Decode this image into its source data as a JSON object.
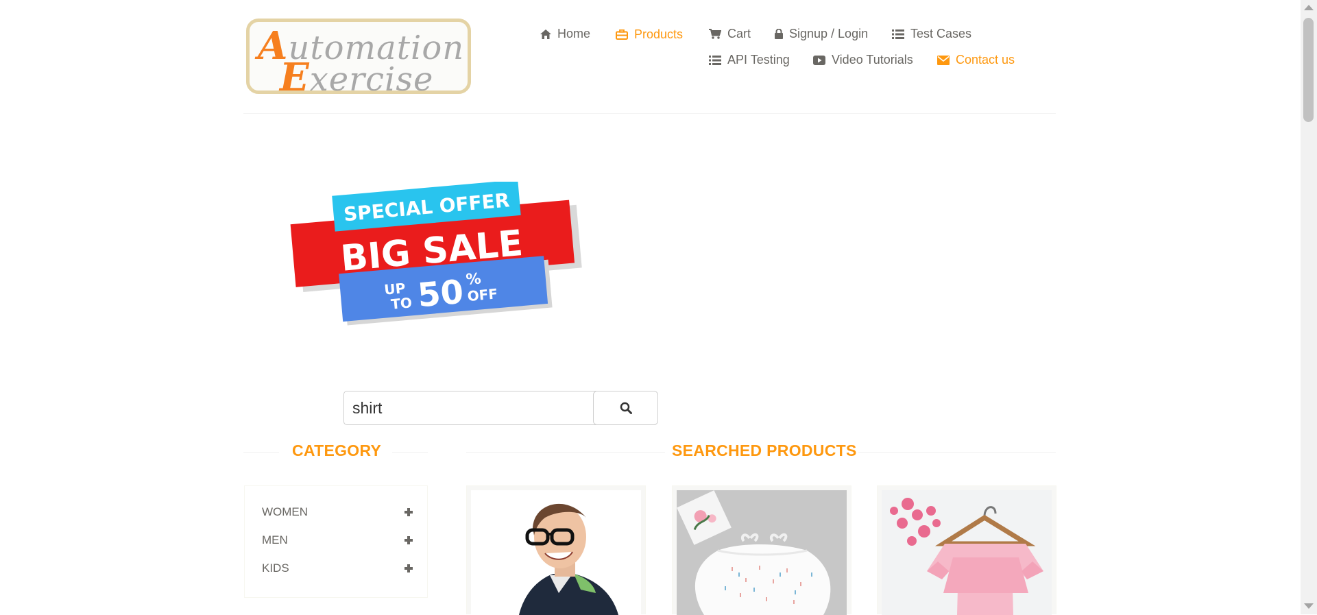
{
  "logo": {
    "line1_cap": "A",
    "line1_rest": "utomation",
    "line2_cap": "E",
    "line2_rest": "xercise"
  },
  "nav": [
    {
      "label": "Home",
      "icon": "home-icon"
    },
    {
      "label": "Products",
      "icon": "briefcase-icon",
      "active": true
    },
    {
      "label": "Cart",
      "icon": "cart-icon"
    },
    {
      "label": "Signup / Login",
      "icon": "lock-icon"
    },
    {
      "label": "Test Cases",
      "icon": "list-icon"
    },
    {
      "label": "API Testing",
      "icon": "list-icon"
    },
    {
      "label": "Video Tutorials",
      "icon": "youtube-icon"
    },
    {
      "label": "Contact us",
      "icon": "envelope-icon",
      "active": true
    }
  ],
  "banner": {
    "line1": "SPECIAL OFFER",
    "line2": "BIG SALE",
    "up": "UP",
    "to": "TO",
    "number": "50",
    "percent": "%",
    "off": "OFF"
  },
  "search": {
    "value": "shirt",
    "button_icon": "search-icon"
  },
  "category": {
    "title": "CATEGORY",
    "items": [
      {
        "label": "WOMEN"
      },
      {
        "label": "MEN"
      },
      {
        "label": "KIDS"
      }
    ]
  },
  "products": {
    "title": "SEARCHED PRODUCTS"
  },
  "colors": {
    "accent": "#fe980f",
    "text": "#696763",
    "logo_orange": "#f67f1f",
    "logo_border": "#e4d3a5"
  }
}
